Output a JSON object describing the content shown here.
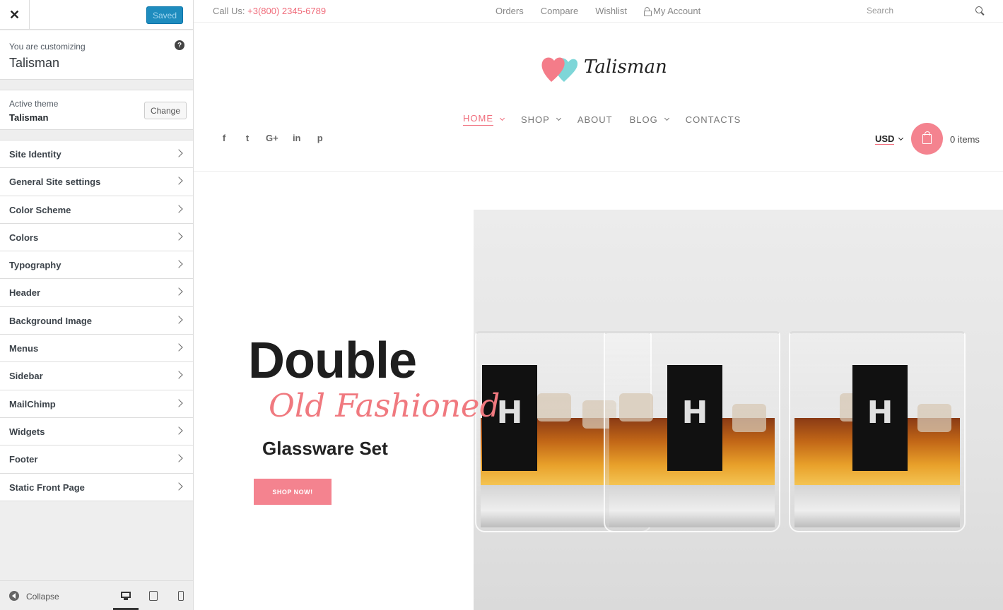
{
  "customizer": {
    "close_label": "✕",
    "saved_label": "Saved",
    "customizing_label": "You are customizing",
    "site_name": "Talisman",
    "help_label": "?",
    "active_theme_label": "Active theme",
    "active_theme_name": "Talisman",
    "change_label": "Change",
    "sections": [
      "Site Identity",
      "General Site settings",
      "Color Scheme",
      "Colors",
      "Typography",
      "Header",
      "Background Image",
      "Menus",
      "Sidebar",
      "MailChimp",
      "Widgets",
      "Footer",
      "Static Front Page"
    ],
    "collapse_label": "Collapse",
    "devices": [
      "desktop-icon",
      "tablet-icon",
      "mobile-icon"
    ]
  },
  "preview": {
    "topbar": {
      "call_label": "Call Us:",
      "phone": "+3(800) 2345-6789",
      "links": [
        "Orders",
        "Compare",
        "Wishlist",
        "My Account"
      ],
      "search_placeholder": "Search"
    },
    "logo_text": "Talisman",
    "nav": [
      "HOME",
      "SHOP",
      "ABOUT",
      "BLOG",
      "CONTACTS"
    ],
    "social": [
      "f",
      "t",
      "G+",
      "in",
      "p"
    ],
    "currency": "USD",
    "cart_count": "0 items",
    "slide": {
      "title": "Double",
      "subtitle": "Old Fashioned",
      "description": "Glassware Set",
      "button": "SHOP NOW!",
      "glass_letter": "H"
    }
  },
  "colors": {
    "accent": "#f06b7a",
    "button": "#f4838f",
    "wp_primary": "#1e8cbe",
    "logo_heart_left": "#f47c89",
    "logo_heart_right": "#7ed6d8"
  }
}
